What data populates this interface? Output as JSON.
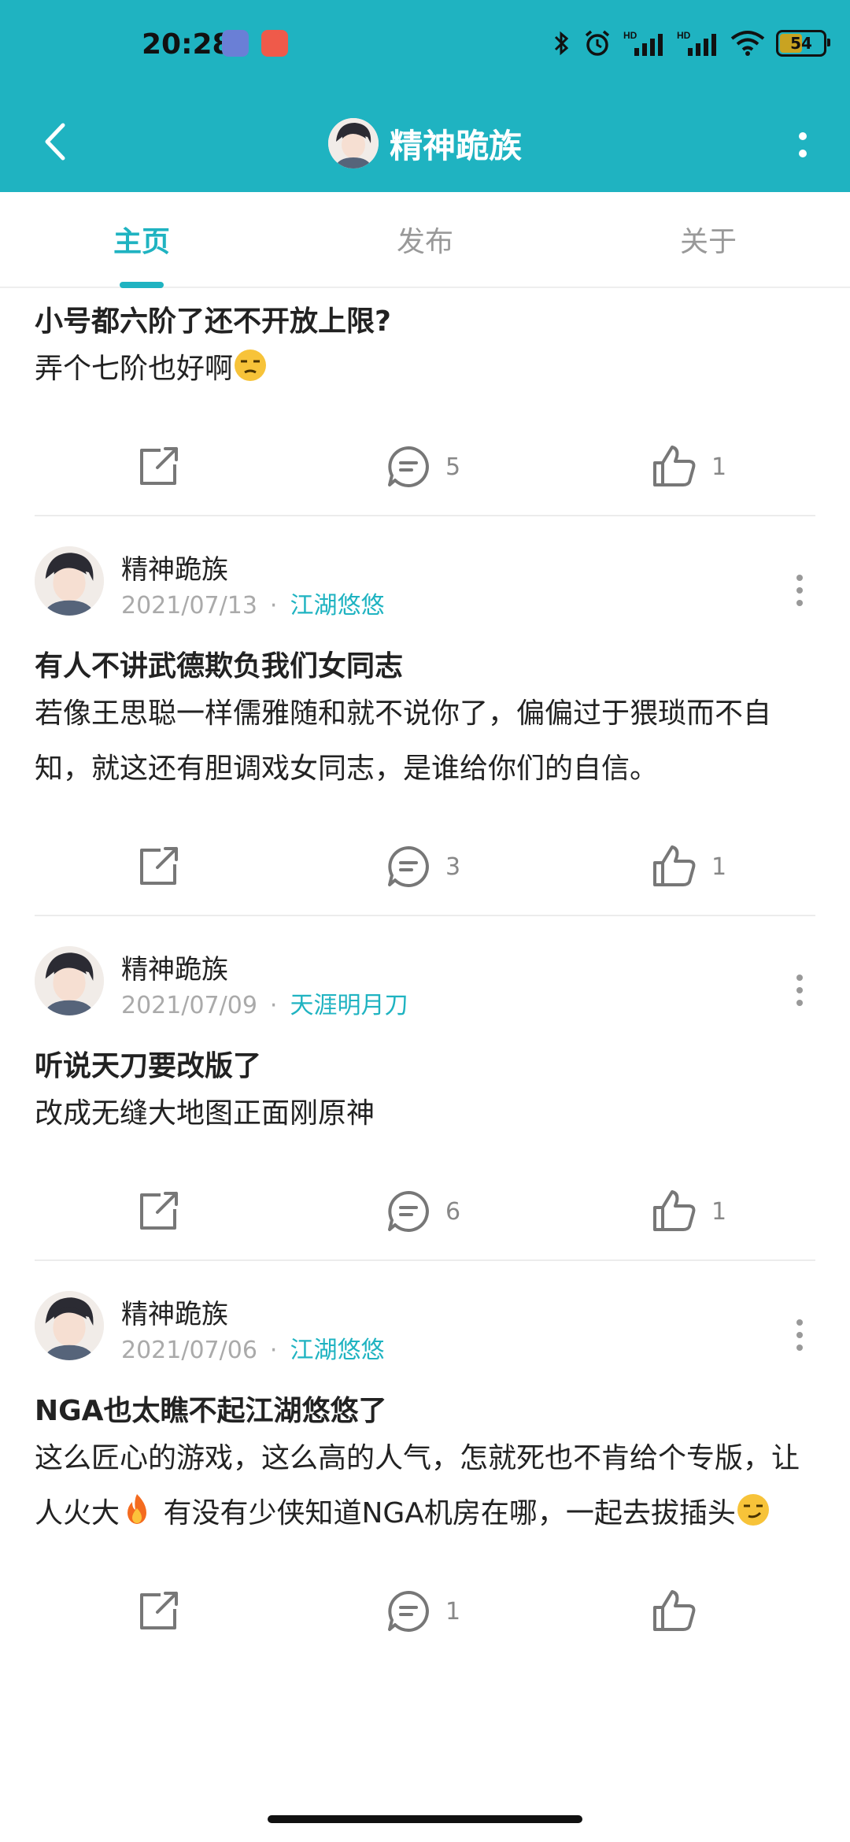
{
  "status_bar": {
    "time": "20:28",
    "battery": "54"
  },
  "header": {
    "title": "精神跪族",
    "back_icon": "back-arrow-icon",
    "more_icon": "more-vertical-icon"
  },
  "tabs": [
    {
      "label": "主页",
      "active": true
    },
    {
      "label": "发布",
      "active": false
    },
    {
      "label": "关于",
      "active": false
    }
  ],
  "posts": [
    {
      "title": "小号都六阶了还不开放上限?",
      "body": "弄个七阶也好啊",
      "body_emoji": "unamused-face-emoji",
      "comments": "5",
      "likes": "1"
    },
    {
      "author": "精神跪族",
      "date": "2021/07/13",
      "forum": "江湖悠悠",
      "title": "有人不讲武德欺负我们女同志",
      "body": "若像王思聪一样儒雅随和就不说你了，偏偏过于猥琐而不自知，就这还有胆调戏女同志，是谁给你们的自信。",
      "comments": "3",
      "likes": "1"
    },
    {
      "author": "精神跪族",
      "date": "2021/07/09",
      "forum": "天涯明月刀",
      "title": "听说天刀要改版了",
      "body": "改成无缝大地图正面刚原神",
      "comments": "6",
      "likes": "1"
    },
    {
      "author": "精神跪族",
      "date": "2021/07/06",
      "forum": "江湖悠悠",
      "title": "NGA也太瞧不起江湖悠悠了",
      "body_part1": "这么匠心的游戏，这么高的人气，怎就死也不肯给个专版，让人火大",
      "body_part2": " 有没有少侠知道NGA机房在哪，一起去拔插头",
      "comments": "1",
      "likes": ""
    }
  ],
  "colors": {
    "accent": "#1fb3c1",
    "text": "#222222",
    "muted": "#aaaaaa"
  }
}
